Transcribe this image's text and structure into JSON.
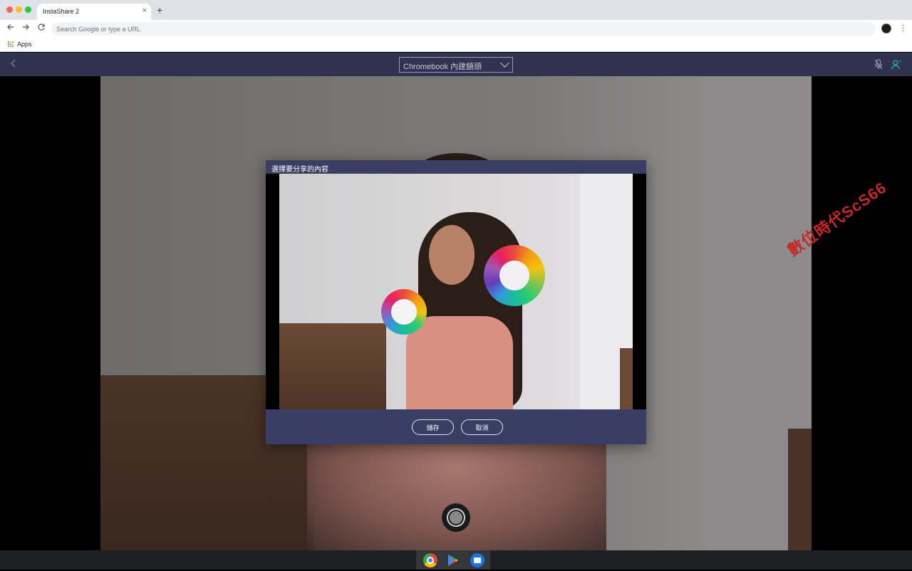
{
  "browser": {
    "tab_title": "InstaShare 2",
    "tab_close": "×",
    "new_tab": "+",
    "omnibox_placeholder": "Search Google or type a URL",
    "bookmarks": {
      "apps_label": "Apps"
    }
  },
  "app": {
    "camera_select": {
      "selected": "Chromebook 內建鏡頭"
    },
    "icons": [
      "back-arrow-icon",
      "mic-off-icon",
      "user-icon"
    ]
  },
  "dialog": {
    "title": "選擇要分享的內容",
    "save_label": "儲存",
    "cancel_label": "取消"
  },
  "watermark": "數位時代ScS66",
  "shelf": {
    "apps": [
      "chrome-icon",
      "play-store-icon",
      "files-icon"
    ]
  },
  "colors": {
    "header_bg": "#30334f",
    "dialog_bg": "#3b3e63",
    "accent_user": "#1fb5a5",
    "watermark": "#c62828"
  }
}
